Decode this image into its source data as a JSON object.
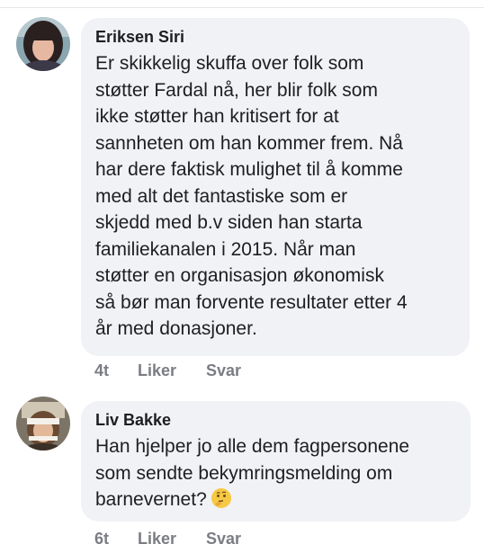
{
  "comments": [
    {
      "author": "Eriksen Siri",
      "text": "Er skikkelig skuffa over folk  som\nstøtter Fardal nå, her blir folk som\nikke støtter han kritisert for at\nsannheten om han kommer frem. Nå\nhar dere faktisk mulighet til å komme\nmed alt det fantastiske som er\nskjedd med b.v siden han starta\nfamiliekanalen i 2015. Når man\nstøtter en organisasjon økonomisk\nså bør man forvente resultater etter 4\når med donasjoner.",
      "time": "4t",
      "like_label": "Liker",
      "reply_label": "Svar"
    },
    {
      "author": "Liv Bakke",
      "text": "Han hjelper jo alle dem fagpersonene\nsom sendte bekymringsmelding om\nbarnevernet?",
      "emoji": "thinking-face",
      "time": "6t",
      "like_label": "Liker",
      "reply_label": "Svar"
    }
  ]
}
